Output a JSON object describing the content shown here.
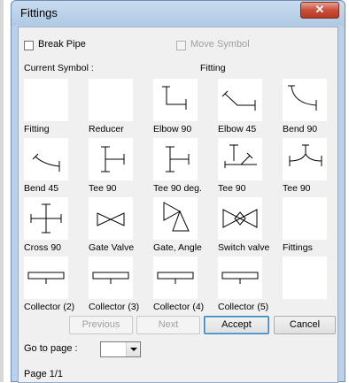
{
  "window": {
    "title": "Fittings",
    "close_glyph": "✕"
  },
  "options": {
    "break_pipe_label": "Break Pipe",
    "move_symbol_label": "Move Symbol"
  },
  "current_symbol": {
    "label": "Current Symbol :",
    "value": "Fitting"
  },
  "grid": [
    {
      "label": "Fitting",
      "icon": "blank"
    },
    {
      "label": "Reducer",
      "icon": "blank"
    },
    {
      "label": "Elbow 90",
      "icon": "elbow-90-icon"
    },
    {
      "label": "Elbow 45",
      "icon": "elbow-45-icon"
    },
    {
      "label": "Bend 90",
      "icon": "bend-90-icon"
    },
    {
      "label": "Bend 45",
      "icon": "bend-45-icon"
    },
    {
      "label": "Tee 90",
      "icon": "tee-90-icon"
    },
    {
      "label": "Tee 90 deg.",
      "icon": "tee-90-deg-icon"
    },
    {
      "label": "Tee 90",
      "icon": "tee-90-angled-icon"
    },
    {
      "label": "Tee 90",
      "icon": "tee-90-bend-icon"
    },
    {
      "label": "Cross 90",
      "icon": "cross-90-icon"
    },
    {
      "label": "Gate Valve",
      "icon": "gate-valve-icon"
    },
    {
      "label": "Gate, Angle",
      "icon": "gate-angle-icon"
    },
    {
      "label": "Switch valve",
      "icon": "switch-valve-icon"
    },
    {
      "label": "Fittings",
      "icon": "blank"
    },
    {
      "label": "Collector (2)",
      "icon": "collector-icon"
    },
    {
      "label": "Collector (3)",
      "icon": "collector-icon"
    },
    {
      "label": "Collector (4)",
      "icon": "collector-icon"
    },
    {
      "label": "Collector (5)",
      "icon": "collector-icon"
    },
    {
      "label": "",
      "icon": "blank"
    }
  ],
  "buttons": {
    "previous": "Previous",
    "next": "Next",
    "accept": "Accept",
    "cancel": "Cancel"
  },
  "goto": {
    "label": "Go to page :",
    "value": ""
  },
  "page_indicator": "Page 1/1"
}
